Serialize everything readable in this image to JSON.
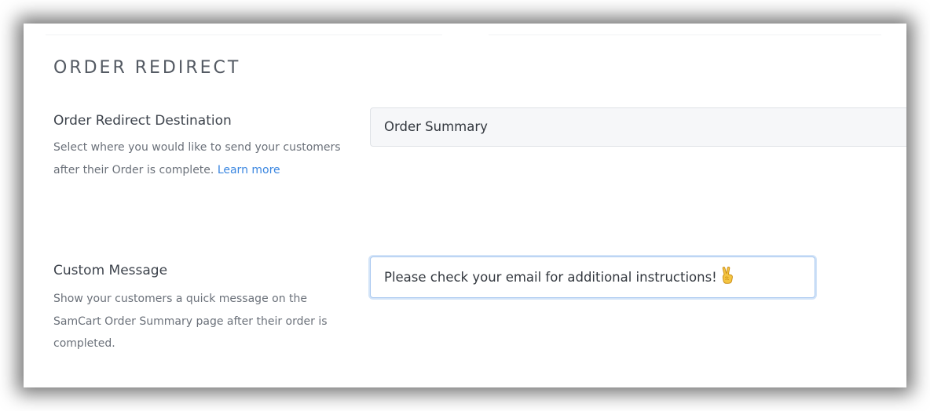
{
  "section": {
    "title": "ORDER REDIRECT"
  },
  "redirect": {
    "label": "Order Redirect Destination",
    "description": "Select where you would like to send your customers after their Order is complete.",
    "learn_more": "Learn more",
    "value": "Order Summary"
  },
  "custom_message": {
    "label": "Custom Message",
    "description": "Show your customers a quick message on the SamCart Order Summary page after their order is completed.",
    "value": "Please check your email for additional instructions!",
    "emoji": "victory-hand-icon"
  },
  "colors": {
    "link": "#3a86e0",
    "focus_border": "#a8c8f0",
    "select_bg": "#f6f7f9"
  }
}
